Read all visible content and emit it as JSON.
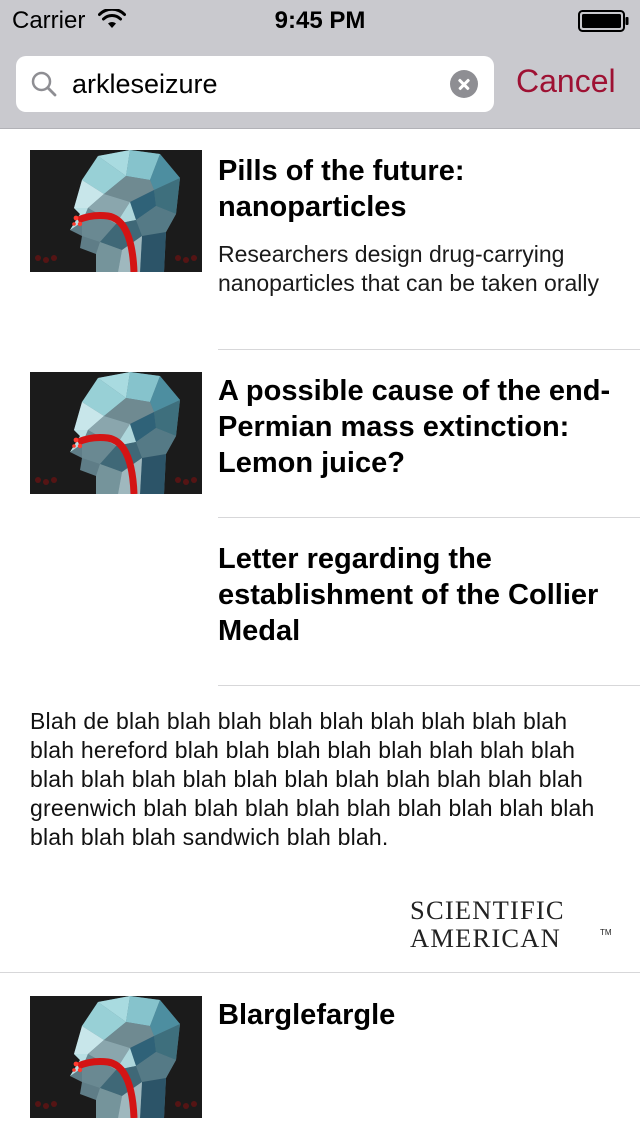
{
  "status_bar": {
    "carrier": "Carrier",
    "time": "9:45 PM",
    "wifi_icon": "wifi-icon",
    "battery_icon": "battery-icon"
  },
  "search": {
    "query": "arkleseizure",
    "search_icon": "search-icon",
    "clear_icon": "clear-icon",
    "cancel_label": "Cancel",
    "accent_color": "#9e1133"
  },
  "results": [
    {
      "title": "Pills of the future: nanoparticles",
      "description": "Researchers design drug-carrying nanoparticles that can be taken orally",
      "has_thumbnail": true
    },
    {
      "title": "A possible cause of the end-Permian mass extinction: Lemon juice?",
      "description": "",
      "has_thumbnail": true
    },
    {
      "title": "Letter regarding the establishment of the Collier Medal",
      "description": "",
      "has_thumbnail": false
    },
    {
      "title": "Blarglefargle",
      "description": "",
      "has_thumbnail": true
    }
  ],
  "blurb": {
    "text": "Blah de blah blah blah blah blah blah blah blah blah blah hereford blah blah blah blah blah blah blah blah blah blah blah blah blah blah blah blah blah blah blah greenwich blah blah blah blah blah blah blah blah blah blah blah blah sandwich blah blah.",
    "logo_line1": "SCIENTIFIC",
    "logo_line2": "AMERICAN",
    "logo_tm": "TM"
  }
}
